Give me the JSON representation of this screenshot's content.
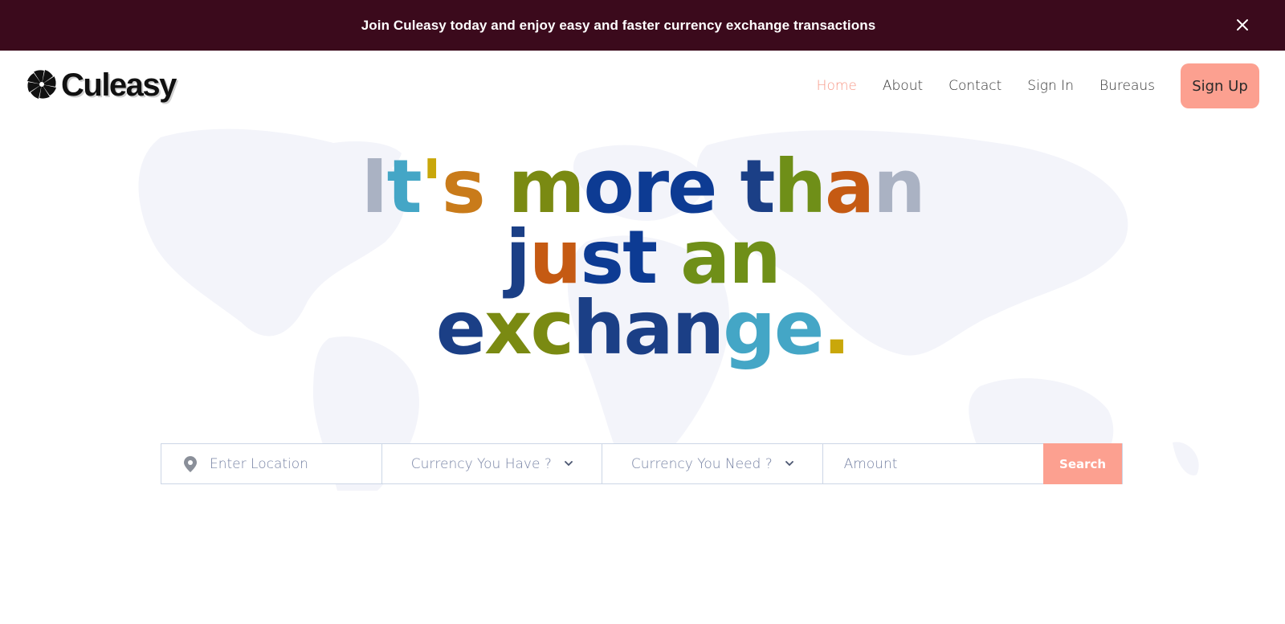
{
  "announcement": {
    "text": "Join Culeasy today and enjoy easy and faster currency exchange transactions",
    "close_icon": "close-icon"
  },
  "brand": {
    "name": "Culeasy",
    "logo_icon": "pinwheel-logo-icon"
  },
  "nav": {
    "items": [
      {
        "label": "Home",
        "active": true
      },
      {
        "label": "About",
        "active": false
      },
      {
        "label": "Contact",
        "active": false
      },
      {
        "label": "Sign In",
        "active": false
      },
      {
        "label": "Bureaus",
        "active": false
      }
    ],
    "signup_label": "Sign Up"
  },
  "hero": {
    "headline_lines": [
      "It's more than",
      "just an",
      "exchange."
    ]
  },
  "search": {
    "location_placeholder": "Enter Location",
    "location_icon": "map-pin-icon",
    "currency_have": "Currency You Have ?",
    "currency_need": "Currency You Need ?",
    "amount_placeholder": "Amount",
    "button_label": "Search"
  },
  "colors": {
    "banner_bg": "#3b0a1c",
    "accent": "#fca090",
    "active_nav": "#f79887",
    "input_text": "#7783a4"
  }
}
